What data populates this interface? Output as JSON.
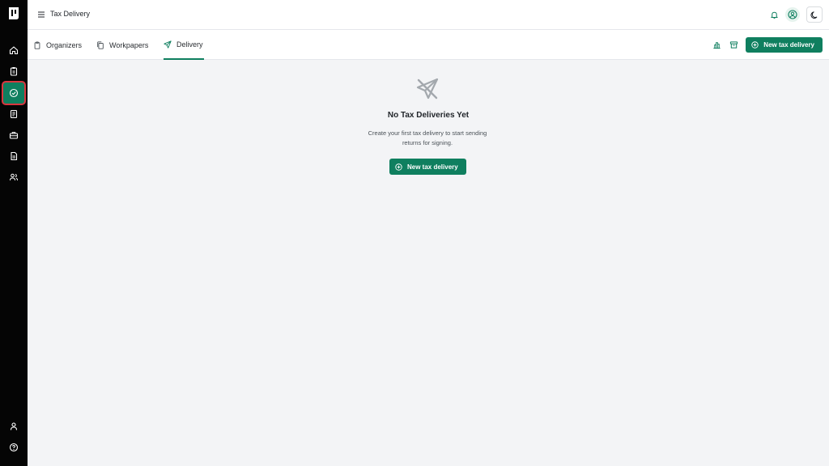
{
  "header": {
    "title": "Tax Delivery"
  },
  "tabs": [
    {
      "label": "Organizers",
      "icon": "clipboard-icon"
    },
    {
      "label": "Workpapers",
      "icon": "copy-icon"
    },
    {
      "label": "Delivery",
      "icon": "send-icon",
      "active": true
    }
  ],
  "toolbar": {
    "new_button_label": "New tax delivery"
  },
  "empty_state": {
    "title": "No Tax Deliveries Yet",
    "description": "Create your first tax delivery to start sending returns for signing.",
    "button_label": "New tax delivery"
  },
  "colors": {
    "accent": "#0f7f5f",
    "sidebar": "#050505",
    "highlight_outline": "#d9363e"
  }
}
